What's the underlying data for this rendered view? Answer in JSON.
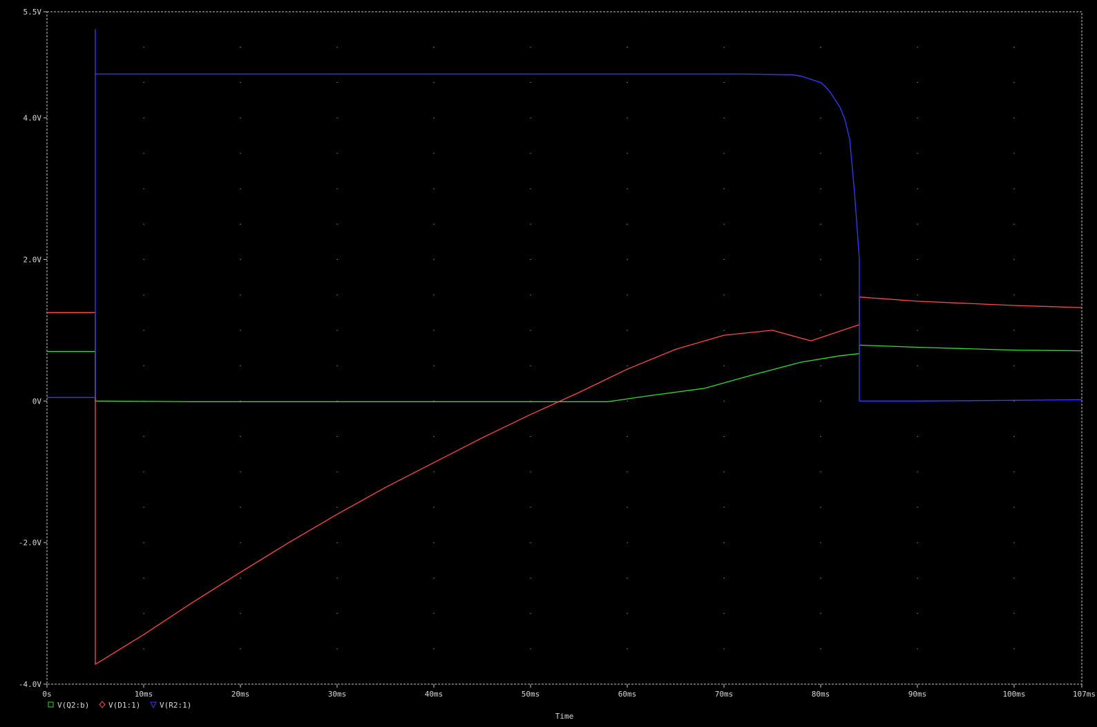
{
  "chart_data": {
    "type": "line",
    "xlabel": "Time",
    "ylabel": "",
    "xlim": [
      0,
      107
    ],
    "ylim": [
      -4.0,
      5.5
    ],
    "grid": true,
    "legend_position": "bottom-left",
    "x_ticks": [
      {
        "value": 0,
        "label": "0s"
      },
      {
        "value": 10,
        "label": "10ms"
      },
      {
        "value": 20,
        "label": "20ms"
      },
      {
        "value": 30,
        "label": "30ms"
      },
      {
        "value": 40,
        "label": "40ms"
      },
      {
        "value": 50,
        "label": "50ms"
      },
      {
        "value": 60,
        "label": "60ms"
      },
      {
        "value": 70,
        "label": "70ms"
      },
      {
        "value": 80,
        "label": "80ms"
      },
      {
        "value": 90,
        "label": "90ms"
      },
      {
        "value": 100,
        "label": "100ms"
      },
      {
        "value": 107,
        "label": "107ms"
      }
    ],
    "y_ticks": [
      {
        "value": 5.5,
        "label": "5.5V"
      },
      {
        "value": 4.0,
        "label": "4.0V"
      },
      {
        "value": 2.0,
        "label": "2.0V"
      },
      {
        "value": 0,
        "label": "0V"
      },
      {
        "value": -2.0,
        "label": "-2.0V"
      },
      {
        "value": -4.0,
        "label": "-4.0V"
      }
    ],
    "series": [
      {
        "name": "V(Q2:b)",
        "color": "#33dd33",
        "marker": "square",
        "points": [
          [
            0,
            0.7
          ],
          [
            5,
            0.7
          ],
          [
            5,
            0.0
          ],
          [
            15,
            -0.01
          ],
          [
            30,
            -0.01
          ],
          [
            45,
            -0.01
          ],
          [
            58,
            -0.01
          ],
          [
            62,
            0.07
          ],
          [
            68,
            0.18
          ],
          [
            73,
            0.37
          ],
          [
            78,
            0.55
          ],
          [
            82,
            0.64
          ],
          [
            84,
            0.67
          ],
          [
            84,
            0.79
          ],
          [
            90,
            0.76
          ],
          [
            100,
            0.72
          ],
          [
            107,
            0.71
          ]
        ]
      },
      {
        "name": "V(D1:1)",
        "color": "#ff4a4a",
        "marker": "diamond",
        "points": [
          [
            0,
            1.25
          ],
          [
            5,
            1.25
          ],
          [
            5,
            -3.72
          ],
          [
            10,
            -3.3
          ],
          [
            15,
            -2.85
          ],
          [
            20,
            -2.42
          ],
          [
            25,
            -2.0
          ],
          [
            30,
            -1.6
          ],
          [
            35,
            -1.22
          ],
          [
            40,
            -0.87
          ],
          [
            45,
            -0.52
          ],
          [
            50,
            -0.19
          ],
          [
            55,
            0.12
          ],
          [
            60,
            0.45
          ],
          [
            65,
            0.73
          ],
          [
            70,
            0.93
          ],
          [
            75,
            1.0
          ],
          [
            79,
            0.85
          ],
          [
            84,
            1.08
          ],
          [
            84,
            1.47
          ],
          [
            90,
            1.41
          ],
          [
            100,
            1.35
          ],
          [
            107,
            1.32
          ]
        ]
      },
      {
        "name": "V(R2:1)",
        "color": "#3a3aff",
        "marker": "triangle",
        "points": [
          [
            0,
            0.05
          ],
          [
            5,
            0.05
          ],
          [
            5,
            5.25
          ],
          [
            5,
            4.62
          ],
          [
            20,
            4.62
          ],
          [
            40,
            4.62
          ],
          [
            60,
            4.62
          ],
          [
            72,
            4.62
          ],
          [
            77,
            4.61
          ],
          [
            78,
            4.59
          ],
          [
            80,
            4.5
          ],
          [
            80.5,
            4.44
          ],
          [
            81,
            4.36
          ],
          [
            82,
            4.15
          ],
          [
            82.5,
            3.98
          ],
          [
            83,
            3.7
          ],
          [
            83.5,
            2.95
          ],
          [
            84,
            2.0
          ],
          [
            84,
            0.0
          ],
          [
            90,
            0.0
          ],
          [
            100,
            0.01
          ],
          [
            107,
            0.02
          ]
        ]
      }
    ]
  }
}
